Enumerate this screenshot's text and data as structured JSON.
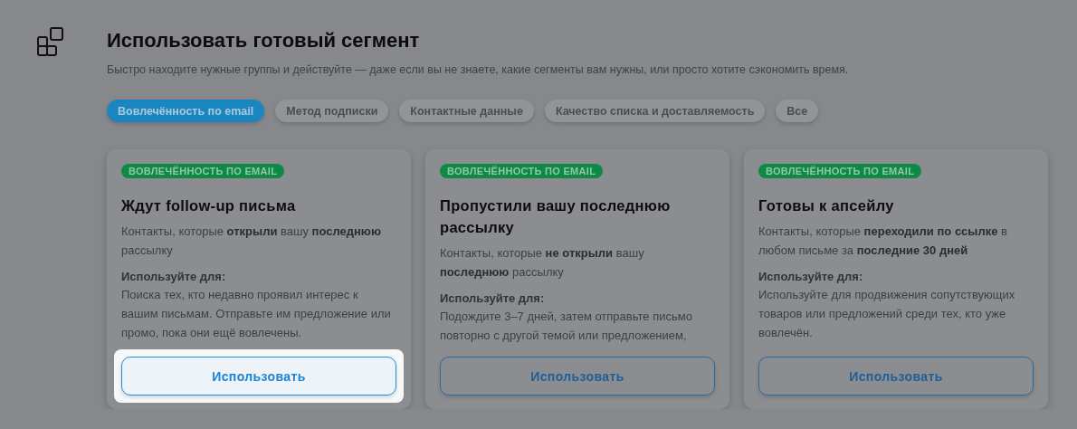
{
  "header": {
    "title": "Использовать готовый сегмент",
    "subtitle": "Быстро находите нужные группы и действуйте — даже если вы не знаете, какие сегменты вам нужны, или просто хотите сэкономить время."
  },
  "filters": [
    {
      "label": "Вовлечённость по email",
      "selected": true
    },
    {
      "label": "Метод подписки",
      "selected": false
    },
    {
      "label": "Контактные данные",
      "selected": false
    },
    {
      "label": "Качество списка и доставляемость",
      "selected": false
    },
    {
      "label": "Все",
      "selected": false
    }
  ],
  "cards": [
    {
      "tag": "ВОВЛЕЧЁННОСТЬ ПО EMAIL",
      "title": "Ждут follow-up письма",
      "description": "Контакты, которые **открыли** вашу **последнюю** рассылку",
      "use_for_label": "Используйте для:",
      "use_for": "Поиска тех, кто недавно проявил интерес к вашим письмам. Отправьте им предложение или промо, пока они ещё вовлечены.",
      "button": "Использовать",
      "highlighted": true
    },
    {
      "tag": "ВОВЛЕЧЁННОСТЬ ПО EMAIL",
      "title": "Пропустили вашу последнюю рассылку",
      "description": "Контакты, которые **не открыли** вашу **последнюю** рассылку",
      "use_for_label": "Используйте для:",
      "use_for": "Подождите 3–7 дней, затем отправьте письмо повторно с другой темой или предложением,",
      "button": "Использовать",
      "highlighted": false
    },
    {
      "tag": "ВОВЛЕЧЁННОСТЬ ПО EMAIL",
      "title": "Готовы к апсейлу",
      "description": "Контакты, которые **переходили по ссылке** в любом письме за **последние 30 дней**",
      "use_for_label": "Используйте для:",
      "use_for": "Используйте для продвижения сопутствующих товаров или предложений среди тех, кто уже вовлечён.",
      "button": "Использовать",
      "highlighted": false
    }
  ]
}
